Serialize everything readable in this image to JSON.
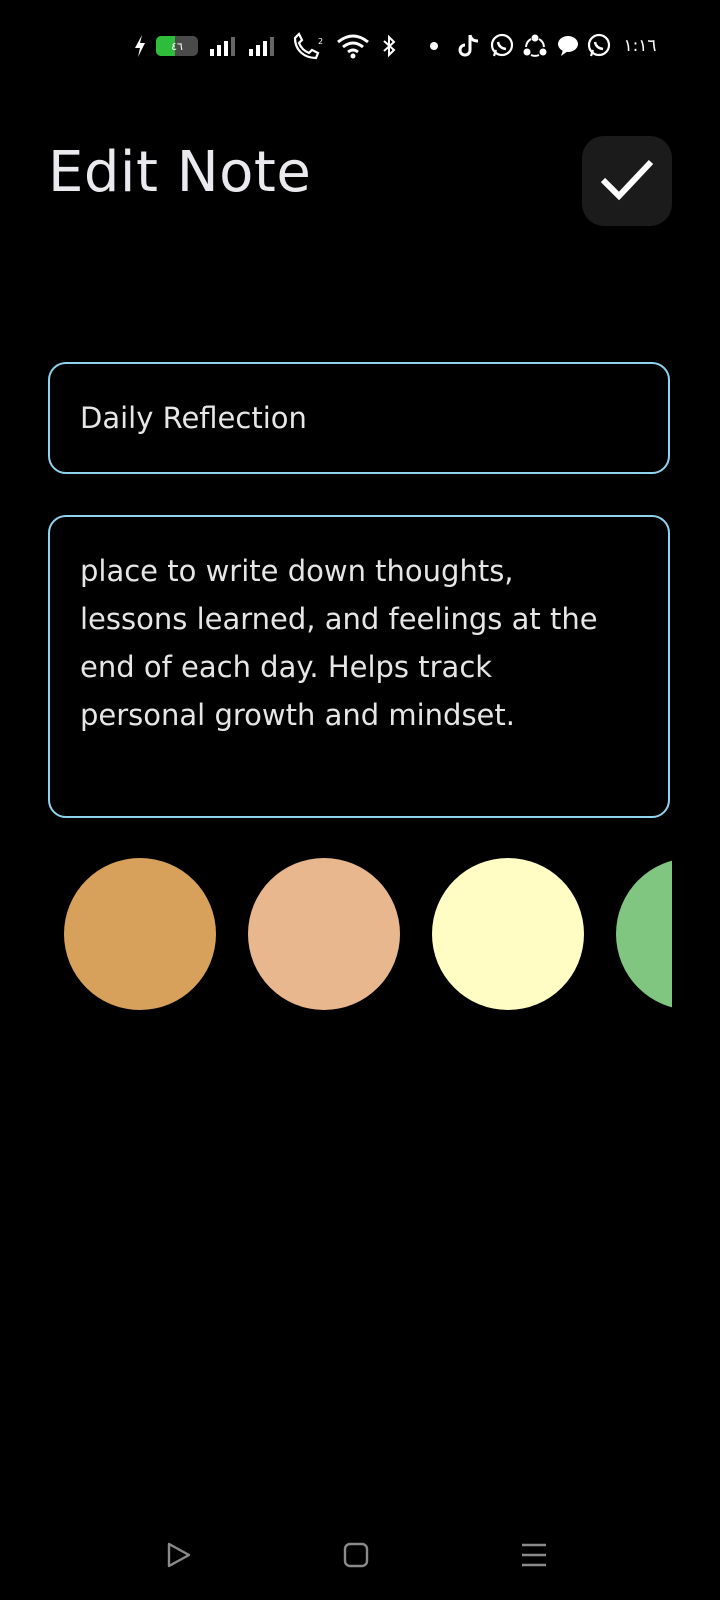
{
  "status_bar": {
    "battery_label": "٤٦",
    "battery_level": 0.46,
    "time": "١:١٦",
    "icons": [
      "charging-icon",
      "battery-icon",
      "signal-1-icon",
      "signal-2-icon",
      "wifi-calling-icon",
      "wifi-icon",
      "bluetooth-icon",
      "dot-icon",
      "tiktok-icon",
      "whatsapp-icon",
      "share-icon",
      "chat-icon",
      "whatsapp-icon"
    ]
  },
  "header": {
    "title": "Edit Note",
    "save_icon": "check-icon"
  },
  "form": {
    "title_value": "Daily Reflection",
    "content_value": "place to write down thoughts,\nlessons learned, and feelings at the\nend of each day. Helps track\npersonal growth and mindset.",
    "field_border_color": "#8fd3ee"
  },
  "color_options": [
    {
      "name": "color-swatch-orange",
      "color": "#d8a15b"
    },
    {
      "name": "color-swatch-peach",
      "color": "#e8b78e"
    },
    {
      "name": "color-swatch-cream",
      "color": "#fffcc4"
    },
    {
      "name": "color-swatch-green",
      "color": "#80c580"
    }
  ],
  "navigation_bar": {
    "icons": [
      "back-triangle-icon",
      "home-square-icon",
      "menu-lines-icon"
    ]
  }
}
